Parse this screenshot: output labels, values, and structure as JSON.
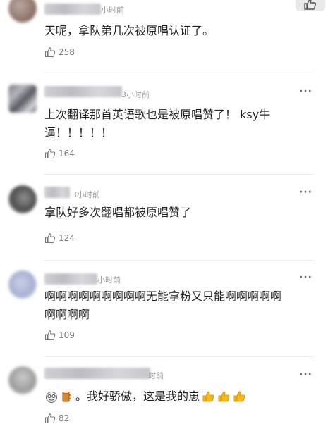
{
  "comments": [
    {
      "time": "小时前",
      "text": "天呢，拿队第几次被原唱认证了。",
      "likes": "258"
    },
    {
      "time": "3小时前",
      "text_line1": "上次翻译那首英语歌也是被原唱赞了！ ksy牛",
      "text_line2": "逼！！！！！",
      "likes": "164",
      "more": "···"
    },
    {
      "time": "3小时前",
      "text": "拿队好多次翻唱都被原唱赞了",
      "likes": "124",
      "more": "···"
    },
    {
      "time": "小时前",
      "text_line1": "啊啊啊啊啊啊啊啊啊无能拿粉又只能啊啊啊啊啊",
      "text_line2": "啊啊啊啊",
      "likes": "109",
      "more": "···"
    },
    {
      "time": "时前",
      "text": "。我好骄傲，这是我的崽",
      "likes": "82",
      "more": "···"
    }
  ],
  "icons": {
    "like": "thumbs-up-outline-icon",
    "more": "more-dots-icon",
    "top_like": "thumbs-up-filled-icon"
  },
  "colors": {
    "text": "#1f1f1f",
    "meta": "#9a9a9a",
    "emoji_thumb": "#f5b91c"
  }
}
